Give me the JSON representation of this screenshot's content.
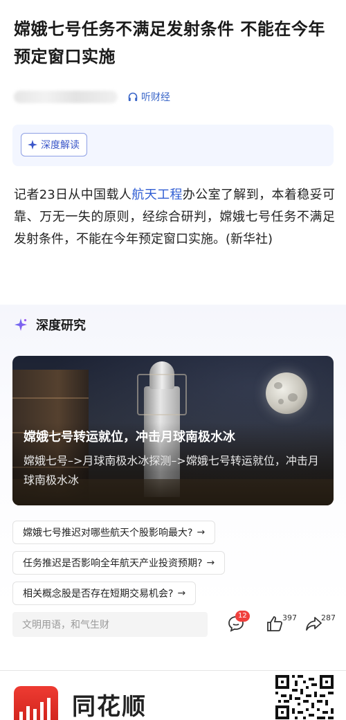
{
  "article": {
    "title": "嫦娥七号任务不满足发射条件 不能在今年预定窗口实施",
    "listen_label": "听财经",
    "deep_read_label": "深度解读",
    "body_pre": "记者23日从中国载人",
    "body_link": "航天工程",
    "body_post": "办公室了解到，本着稳妥可靠、万无一失的原则，经综合研判，嫦娥七号任务不满足发射条件，不能在今年预定窗口实施。(新华社)"
  },
  "research": {
    "heading": "深度研究",
    "card": {
      "title": "嫦娥七号转运就位，冲击月球南极水冰",
      "subtitle": "嫦娥七号–>月球南极水冰探测–>嫦娥七号转运就位，冲击月球南极水冰"
    },
    "questions": [
      {
        "text": "嫦娥七号推迟对哪些航天个股影响最大?",
        "arrow": "→"
      },
      {
        "text": "任务推迟是否影响全年航天产业投资预期?",
        "arrow": "→"
      },
      {
        "text": "相关概念股是否存在短期交易机会?",
        "arrow": "→"
      }
    ]
  },
  "bottom_bar": {
    "comment_placeholder": "文明用语，和气生财",
    "comments_count": "12",
    "likes_count": "397",
    "shares_count": "287"
  },
  "footer": {
    "brand": "同花顺"
  },
  "colors": {
    "link_blue": "#2f5dd3",
    "badge_red": "#f0403d",
    "brand_red": "#e0302a",
    "accent_purple": "#3b57c9"
  },
  "icons": {
    "listen": "headphones-icon",
    "deep_read": "sparkle-icon",
    "research": "sparkle-icon",
    "comment": "comment-icon",
    "like": "thumbs-up-icon",
    "share": "share-icon",
    "qr": "qr-code-icon"
  }
}
